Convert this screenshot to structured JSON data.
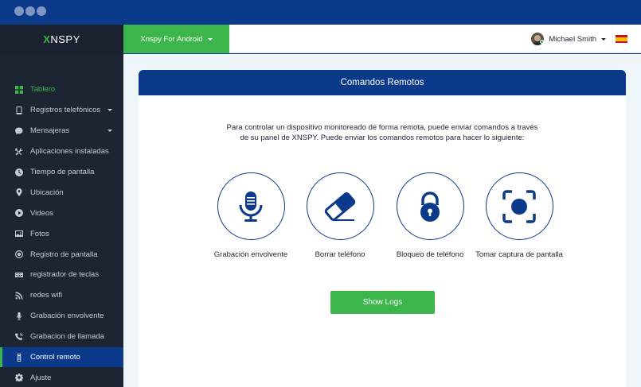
{
  "brand": {
    "logo_x": "X",
    "logo_rest": "NSPY"
  },
  "topbar": {
    "device": "Xnspy For Android",
    "user_name": "Michael Smith"
  },
  "sidebar": {
    "items": [
      {
        "label": "Tablero",
        "icon": "dashboard-icon"
      },
      {
        "label": "Registros telefónicos",
        "icon": "phone-icon"
      },
      {
        "label": "Mensajeras",
        "icon": "chat-icon"
      },
      {
        "label": "Aplicaciones instaladas",
        "icon": "tools-icon"
      },
      {
        "label": "Tiempo de pantalla",
        "icon": "clock-icon"
      },
      {
        "label": "Ubicación",
        "icon": "location-pin-icon"
      },
      {
        "label": "Videos",
        "icon": "play-icon"
      },
      {
        "label": "Fotos",
        "icon": "image-icon"
      },
      {
        "label": "Registro de pantalla",
        "icon": "record-icon"
      },
      {
        "label": "registrador de teclas",
        "icon": "keyboard-icon"
      },
      {
        "label": "redes wifi",
        "icon": "wifi-icon"
      },
      {
        "label": "Grabación envolvente",
        "icon": "microphone-icon"
      },
      {
        "label": "Grabacion de llamada",
        "icon": "call-recording-icon"
      },
      {
        "label": "Control remoto",
        "icon": "remote-control-icon"
      },
      {
        "label": "Ajuste",
        "icon": "gear-icon"
      }
    ]
  },
  "main": {
    "title": "Comandos Remotos",
    "intro_line1": "Para controlar un dispositivo monitoreado de forma remota, puede enviar comandos a través",
    "intro_line2": "de su panel de XNSPY. Puede enviar los comandos remotos para hacer lo siguiente:",
    "features": [
      {
        "label": "Grabación envolvente",
        "icon": "microphone-icon"
      },
      {
        "label": "Borrar teléfono",
        "icon": "eraser-icon"
      },
      {
        "label": "Bloqueo de teléfono",
        "icon": "padlock-icon"
      },
      {
        "label": "Tomar captura de pantalla",
        "icon": "screenshot-icon"
      }
    ],
    "logs_button": "Show Logs"
  },
  "colors": {
    "navy": "#0b3a8a",
    "green": "#3cb64a",
    "sidebar": "#1d2533"
  }
}
